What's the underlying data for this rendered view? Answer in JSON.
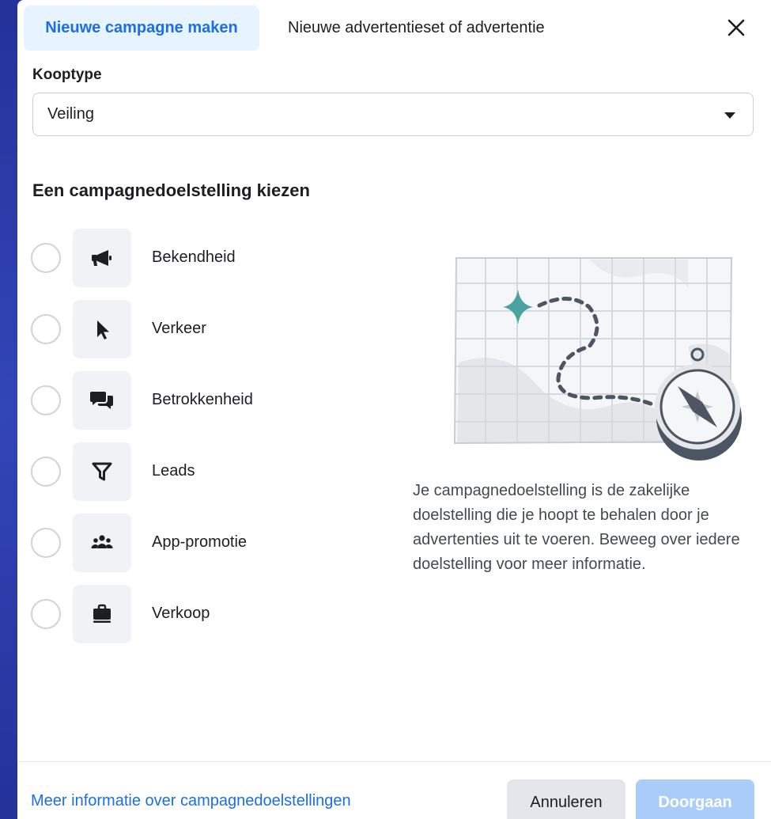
{
  "tabs": {
    "active": "Nieuwe campagne maken",
    "secondary": "Nieuwe advertentieset of advertentie"
  },
  "buying_type": {
    "label": "Kooptype",
    "value": "Veiling"
  },
  "objective": {
    "title": "Een campagnedoelstelling kiezen",
    "options": [
      {
        "label": "Bekendheid",
        "icon": "megaphone-icon"
      },
      {
        "label": "Verkeer",
        "icon": "cursor-icon"
      },
      {
        "label": "Betrokkenheid",
        "icon": "chat-bubbles-icon"
      },
      {
        "label": "Leads",
        "icon": "funnel-icon"
      },
      {
        "label": "App-promotie",
        "icon": "people-icon"
      },
      {
        "label": "Verkoop",
        "icon": "briefcase-icon"
      }
    ],
    "description": "Je campagnedoelstelling is de zakelijke doelstelling die je hoopt te behalen door je advertenties uit te voeren. Beweeg over iedere doelstelling voor meer informatie."
  },
  "footer": {
    "learn_more": "Meer informatie over campagnedoelstellingen",
    "cancel": "Annuleren",
    "continue": "Doorgaan"
  },
  "colors": {
    "accent": "#1b6fe3",
    "accent_bg": "#e7f3ff",
    "disabled_button": "#a9ccf8",
    "star": "#4aa3a0"
  }
}
